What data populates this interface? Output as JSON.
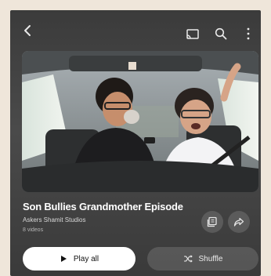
{
  "playlist": {
    "title": "Son Bullies Grandmother Episode",
    "channel": "Askers Shamit Studios",
    "video_count": "8 videos"
  },
  "actions": {
    "play_all_label": "Play all",
    "shuffle_label": "Shuffle"
  },
  "icons": {
    "back": "back-arrow-icon",
    "cast": "cast-icon",
    "search": "search-icon",
    "more": "more-vertical-icon",
    "save": "save-to-library-icon",
    "share": "share-icon",
    "play": "play-icon",
    "shuffle": "shuffle-icon"
  },
  "colors": {
    "background": "#efe6da",
    "panel": "#3f3f3f",
    "play_button": "#ffffff"
  }
}
